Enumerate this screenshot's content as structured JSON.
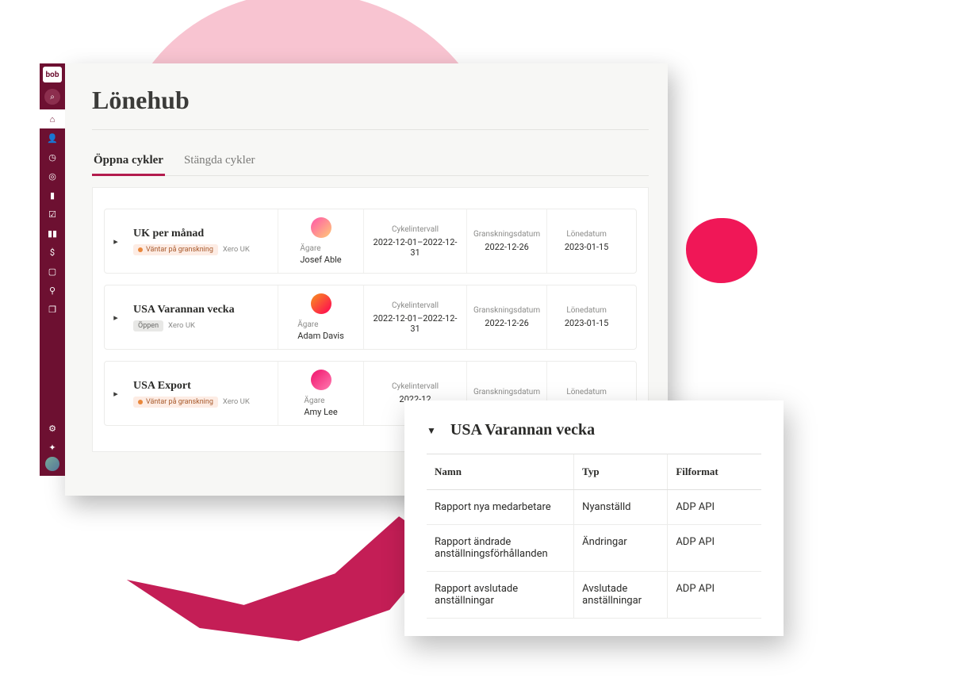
{
  "logo": "bob",
  "sidebar_icons": [
    {
      "name": "search-icon",
      "glyph": "⌕"
    },
    {
      "name": "home-icon",
      "glyph": "⌂",
      "active": true
    },
    {
      "name": "person-add-icon",
      "glyph": "👤"
    },
    {
      "name": "clock-icon",
      "glyph": "◷"
    },
    {
      "name": "ring-icon",
      "glyph": "◎"
    },
    {
      "name": "document-icon",
      "glyph": "▮"
    },
    {
      "name": "checkbox-icon",
      "glyph": "☑"
    },
    {
      "name": "chart-icon",
      "glyph": "▮▮"
    },
    {
      "name": "money-icon",
      "glyph": "$"
    },
    {
      "name": "clipboard-icon",
      "glyph": "▢"
    },
    {
      "name": "org-icon",
      "glyph": "⚲"
    },
    {
      "name": "gift-icon",
      "glyph": "❐"
    }
  ],
  "sidebar_bottom": [
    {
      "name": "gear-icon",
      "glyph": "⚙"
    },
    {
      "name": "bell-icon",
      "glyph": "✦"
    }
  ],
  "page_title": "Lönehub",
  "tabs": [
    {
      "label": "Öppna cykler",
      "active": true
    },
    {
      "label": "Stängda cykler",
      "active": false
    }
  ],
  "column_labels": {
    "owner": "Ägare",
    "interval": "Cykelintervall",
    "review": "Granskningsdatum",
    "paydate": "Lönedatum"
  },
  "cycles": [
    {
      "name": "UK per månad",
      "status": {
        "text": "Väntar på granskning",
        "kind": "pending"
      },
      "source": "Xero UK",
      "owner": "Josef Able",
      "interval": "2022-12-01–2022-12-31",
      "review": "2022-12-26",
      "paydate": "2023-01-15"
    },
    {
      "name": "USA Varannan vecka",
      "status": {
        "text": "Öppen",
        "kind": "open"
      },
      "source": "Xero UK",
      "owner": "Adam Davis",
      "interval": "2022-12-01–2022-12-31",
      "review": "2022-12-26",
      "paydate": "2023-01-15"
    },
    {
      "name": "USA Export",
      "status": {
        "text": "Väntar på granskning",
        "kind": "pending"
      },
      "source": "Xero UK",
      "owner": "Amy Lee",
      "interval": "2022-12",
      "review": "",
      "paydate": ""
    }
  ],
  "popup": {
    "title": "USA Varannan vecka",
    "headers": {
      "name": "Namn",
      "type": "Typ",
      "format": "Filformat"
    },
    "rows": [
      {
        "name": "Rapport nya medarbetare",
        "type": "Nyanställd",
        "format": "ADP API"
      },
      {
        "name": "Rapport ändrade anställningsförhållanden",
        "type": "Ändringar",
        "format": "ADP API"
      },
      {
        "name": "Rapport avslutade anställningar",
        "type": "Avslutade anställningar",
        "format": "ADP API"
      }
    ]
  }
}
